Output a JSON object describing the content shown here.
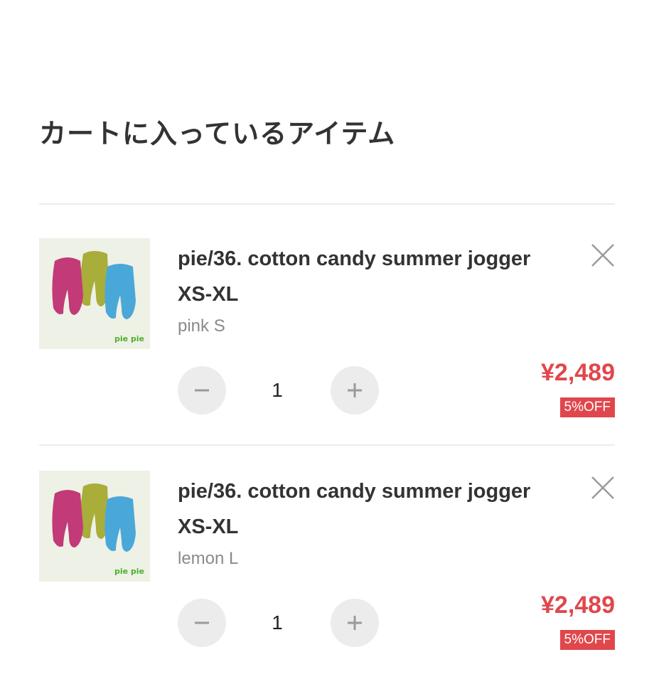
{
  "page": {
    "title": "カートに入っているアイテム"
  },
  "colors": {
    "price": "#e0474c",
    "badge_bg": "#e0474c",
    "qty_button_bg": "#ececec",
    "divider": "#ececec"
  },
  "cart": {
    "items": [
      {
        "thumbnail_brand": "pie pie",
        "name": "pie/36. cotton candy summer jogger XS-XL",
        "variant": "pink S",
        "quantity": "1",
        "price": "¥2,489",
        "discount": "5%OFF",
        "remove_icon": "close-icon",
        "minus_icon": "minus-icon",
        "plus_icon": "plus-icon"
      },
      {
        "thumbnail_brand": "pie pie",
        "name": "pie/36. cotton candy summer jogger XS-XL",
        "variant": "lemon L",
        "quantity": "1",
        "price": "¥2,489",
        "discount": "5%OFF",
        "remove_icon": "close-icon",
        "minus_icon": "minus-icon",
        "plus_icon": "plus-icon"
      }
    ]
  }
}
